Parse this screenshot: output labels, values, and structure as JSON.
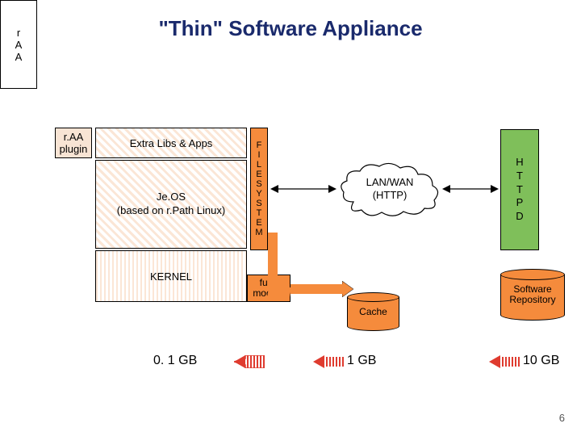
{
  "title": "\"Thin\" Software Appliance",
  "blocks": {
    "raa_plugin": "r.AA\nplugin",
    "extra_libs": "Extra Libs & Apps",
    "raa": "r\nA\nA",
    "jeos": "Je.OS\n(based on r.Path Linux)",
    "kernel": "KERNEL",
    "filesystem": "F\nI\nL\nE\nS\nY\nS\nT\nE\nM",
    "fuse": "fuse\nmodule",
    "httpd": "H\nT\nT\nP\nD",
    "lanwan": "LAN/WAN\n(HTTP)",
    "cache": "Cache",
    "repo": "Software\nRepository"
  },
  "sizes": {
    "left": "0. 1 GB",
    "middle": "1 GB",
    "right": "10 GB"
  },
  "page_number": "6",
  "colors": {
    "orange": "#f58b3c",
    "green": "#7fbf5a",
    "hatch_light": "#fbe6d6",
    "title": "#1a2a6c"
  }
}
